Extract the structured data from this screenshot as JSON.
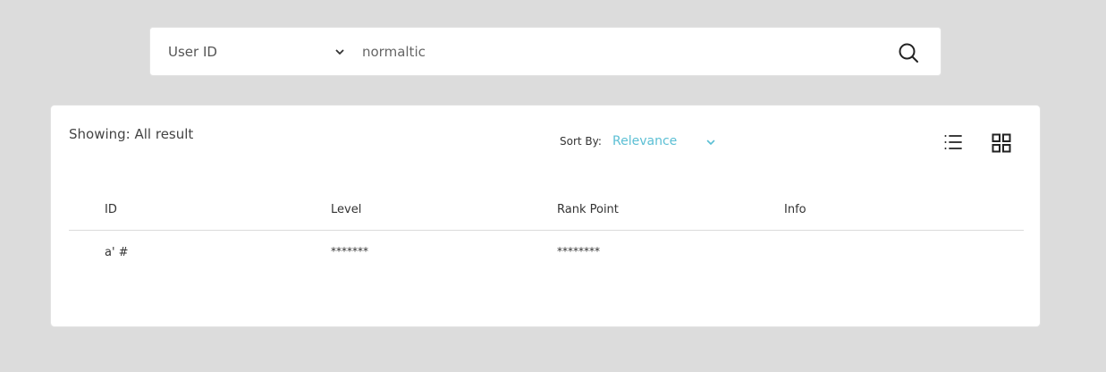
{
  "search": {
    "type_label": "User ID",
    "query": "normaltic"
  },
  "results": {
    "showing_text": "Showing: All result",
    "sort_label": "Sort By:",
    "sort_value": "Relevance",
    "accent_color": "#5bbfd4",
    "view_icons": [
      "list-view-icon",
      "grid-view-icon"
    ],
    "columns": [
      "ID",
      "Level",
      "Rank Point",
      "Info"
    ],
    "rows": [
      {
        "id": "a' #",
        "level": "*******",
        "rank_point": "********",
        "info": ""
      }
    ]
  }
}
